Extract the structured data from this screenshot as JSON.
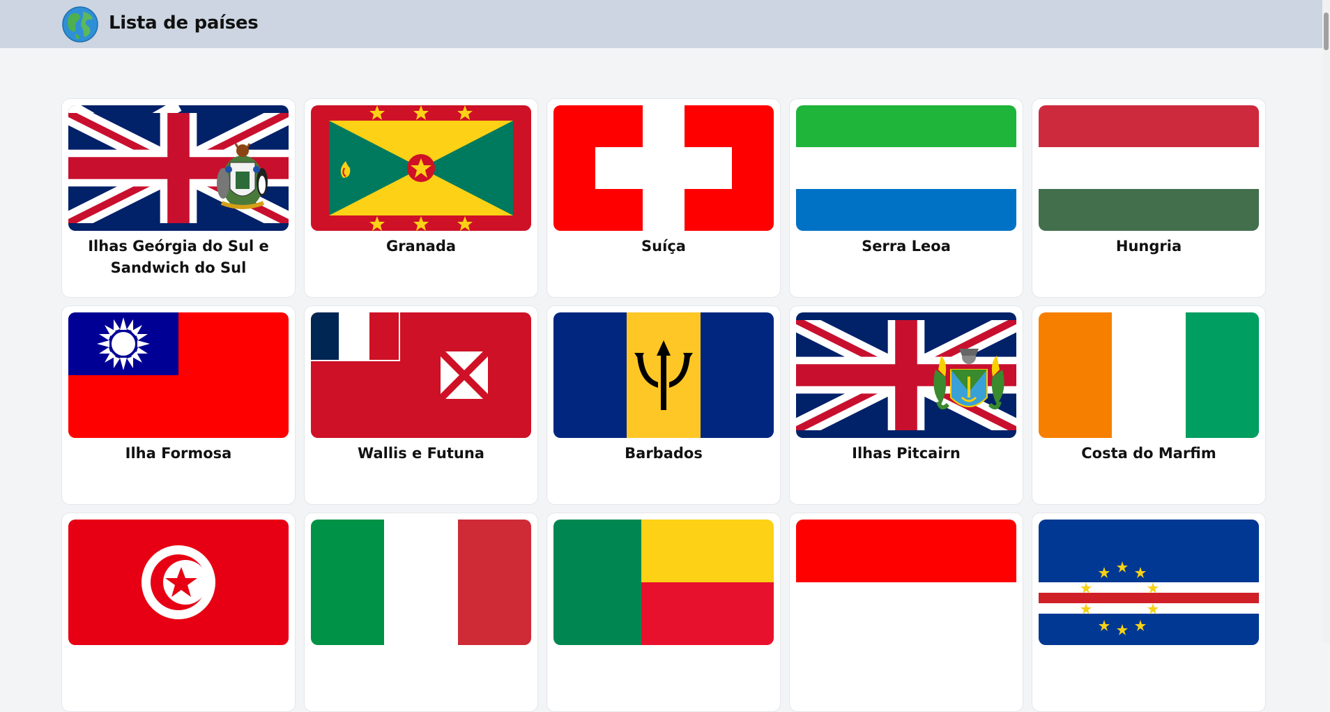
{
  "header": {
    "title": "Lista de países",
    "logo_icon": "globe-icon"
  },
  "countries": [
    {
      "name": "Ilhas Geórgia do Sul e Sandwich do Sul",
      "flag": "south-georgia"
    },
    {
      "name": "Granada",
      "flag": "grenada"
    },
    {
      "name": "Suíça",
      "flag": "switzerland"
    },
    {
      "name": "Serra Leoa",
      "flag": "sierra-leone"
    },
    {
      "name": "Hungria",
      "flag": "hungary"
    },
    {
      "name": "Ilha Formosa",
      "flag": "taiwan"
    },
    {
      "name": "Wallis e Futuna",
      "flag": "wallis-futuna"
    },
    {
      "name": "Barbados",
      "flag": "barbados"
    },
    {
      "name": "Ilhas Pitcairn",
      "flag": "pitcairn"
    },
    {
      "name": "Costa do Marfim",
      "flag": "ivory-coast"
    },
    {
      "name": "",
      "flag": "tunisia"
    },
    {
      "name": "",
      "flag": "italy"
    },
    {
      "name": "",
      "flag": "benin"
    },
    {
      "name": "",
      "flag": "indonesia"
    },
    {
      "name": "",
      "flag": "cape-verde"
    }
  ],
  "colors": {
    "header_bg": "#ccd5e1",
    "page_bg": "#f2f4f6",
    "card_bg": "#ffffff"
  }
}
